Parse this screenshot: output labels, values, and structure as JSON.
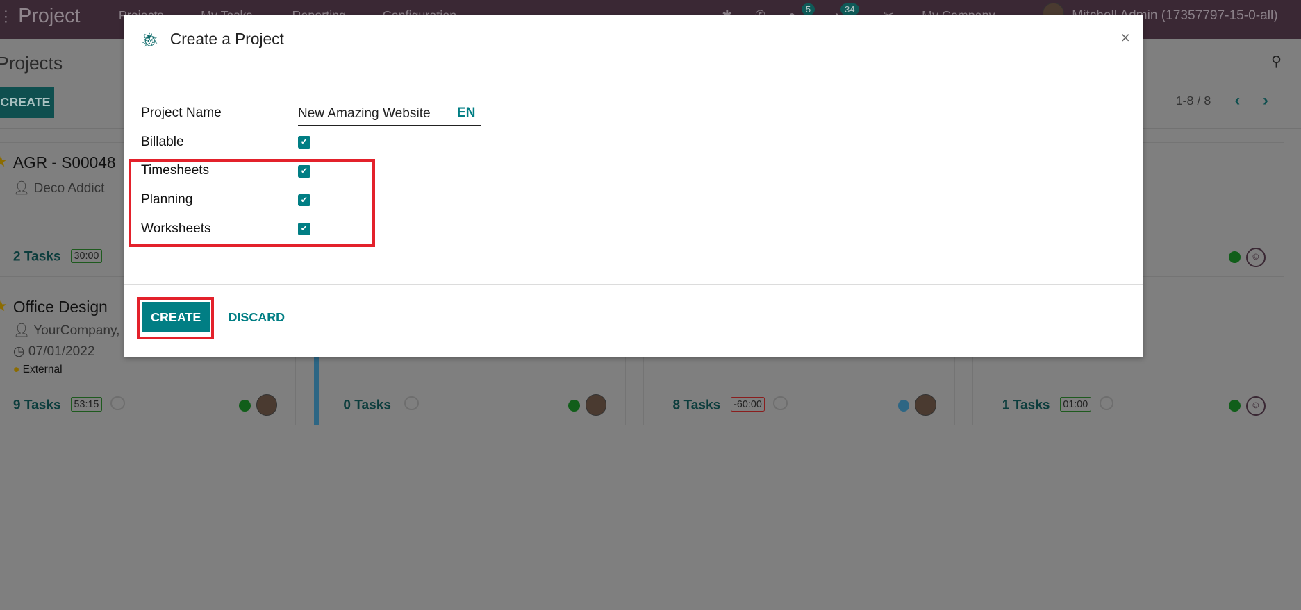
{
  "navbar": {
    "app": "Project",
    "menu": [
      "Projects",
      "My Tasks",
      "Reporting",
      "Configuration"
    ],
    "messages_count": "5",
    "activities_count": "34",
    "company": "My Company",
    "user": "Mitchell Admin (17357797-15-0-all)"
  },
  "control": {
    "title": "Projects",
    "create_label": "CREATE",
    "pager": "1-8 / 8"
  },
  "cards": [
    {
      "title": "AGR - S00048",
      "customer": "Deco Addict",
      "tasks_count": "2",
      "tasks_label": "Tasks",
      "hours": "30:00"
    },
    {
      "title": "Office Design",
      "customer": "YourCompany, J",
      "date": "07/01/2022",
      "tag": "External",
      "tasks_count": "9",
      "tasks_label": "Tasks",
      "hours": "53:15"
    },
    {
      "tasks_count": "0",
      "tasks_label": "Tasks"
    },
    {
      "tasks_count": "8",
      "tasks_label": "Tasks",
      "hours": "-60:00"
    },
    {
      "tasks_count": "1",
      "tasks_label": "Tasks",
      "hours": "01:00"
    }
  ],
  "modal": {
    "title": "Create a Project",
    "close": "×",
    "fields": {
      "project_name_label": "Project Name",
      "project_name_value": "New Amazing Website",
      "lang": "EN",
      "checkboxes": [
        {
          "label": "Billable",
          "checked": true
        },
        {
          "label": "Timesheets",
          "checked": true
        },
        {
          "label": "Planning",
          "checked": true
        },
        {
          "label": "Worksheets",
          "checked": true
        }
      ]
    },
    "create_label": "CREATE",
    "discard_label": "DISCARD"
  },
  "colors": {
    "accent": "#017e84",
    "highlight": "#e3212b",
    "navbar": "#714b67"
  }
}
